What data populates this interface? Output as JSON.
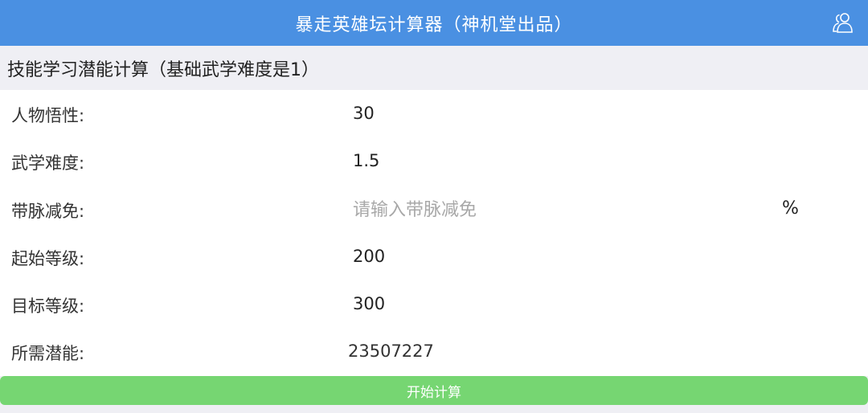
{
  "header": {
    "title": "暴走英雄坛计算器（神机堂出品）",
    "user_icon": "user-group-icon"
  },
  "section": {
    "title": "技能学习潜能计算（基础武学难度是1）"
  },
  "form": {
    "rows": [
      {
        "label": "人物悟性:",
        "value": "30"
      },
      {
        "label": "武学难度:",
        "value": "1.5"
      },
      {
        "label": "带脉减免:",
        "value": "",
        "placeholder": "请输入带脉减免",
        "unit": "%"
      },
      {
        "label": "起始等级:",
        "value": "200"
      },
      {
        "label": "目标等级:",
        "value": "300"
      },
      {
        "label": "所需潜能:",
        "value": "23507227"
      }
    ]
  },
  "button": {
    "label": "开始计算",
    "color": "#76d672"
  },
  "colors": {
    "header": "#4a90e2",
    "background": "#efeff4"
  }
}
